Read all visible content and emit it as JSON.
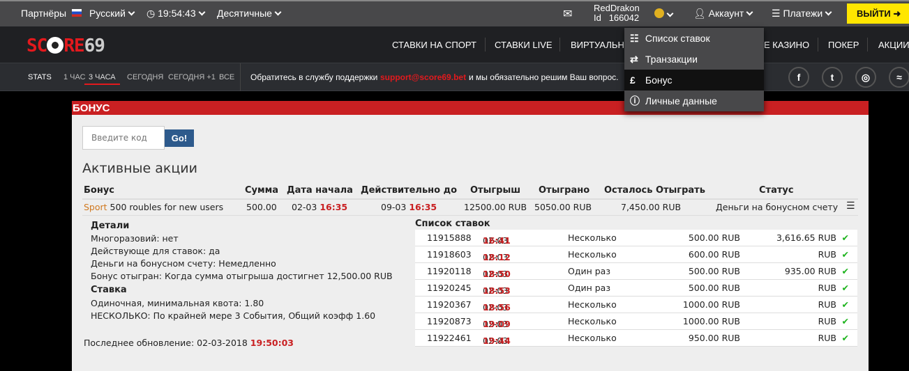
{
  "topbar": {
    "partners": "Партнёры",
    "language": "Русский",
    "time": "19:54:43",
    "odds_format": "Десятичные",
    "username": "RedDrakon",
    "user_id_label": "Id",
    "user_id": "166042",
    "account": "Аккаунт",
    "payments": "Платежи",
    "logout": "ВЫЙТИ"
  },
  "logo": {
    "text_red": "SC",
    "text_red2": "RE",
    "text_grey": "69"
  },
  "nav": {
    "items": [
      "СТАВКИ НА СПОРТ",
      "СТАВКИ LIVE",
      "ВИРТУАЛЬН",
      "Е КАЗИНО",
      "ПОКЕР",
      "АКЦИИ"
    ]
  },
  "stats": {
    "label": "STATS",
    "filters": [
      "1 ЧАС",
      "3 ЧАСА",
      "СЕГОДНЯ",
      "СЕГОДНЯ +1",
      "ВСЕ"
    ],
    "active_filter": "3 ЧАСА",
    "support_text": "Обратитесь в службу поддержки",
    "support_email": "support@score69.bet",
    "support_text2": "и мы обязательно решим Ваш вопрос.",
    "social": [
      "facebook-icon",
      "twitter-icon",
      "instagram-icon",
      "rss-icon"
    ]
  },
  "account_menu": {
    "items": [
      {
        "icon": "list-icon",
        "label": "Список ставок"
      },
      {
        "icon": "transfer-icon",
        "label": "Транзакции"
      },
      {
        "icon": "pound-icon",
        "label": "Бонус"
      },
      {
        "icon": "info-icon",
        "label": "Личные данные"
      }
    ],
    "active": "Бонус"
  },
  "bonus": {
    "title": "БОНУС",
    "code_placeholder": "Введите код",
    "go": "Go!",
    "active_title": "Активные акции",
    "headers": [
      "Бонус",
      "Сумма",
      "Дата начала",
      "Действительно до",
      "Отыгрыш",
      "Отыграно",
      "Осталось Отыграть",
      "Статус"
    ],
    "row": {
      "type": "Sport",
      "name": "500 roubles for new users",
      "amount": "500.00",
      "start_date": "02-03",
      "start_time": "16:35",
      "end_date": "09-03",
      "end_time": "16:35",
      "wager": "12500.00 RUB",
      "wagered": "5050.00 RUB",
      "remaining": "7,450.00 RUB",
      "status": "Деньги на бонусном счету"
    },
    "details_title": "Детали",
    "details": [
      "Многоразовий: нет",
      "Действующе для ставок: да",
      "Деньги на бонусном счету: Немедленно",
      "Бонус отыгран: Когда сумма отыгрыша достигнет 12,500.00 RUB"
    ],
    "bet_title": "Ставка",
    "bet_rules": [
      "Одиночная, минимальная квота: 1.80",
      "НЕСКОЛЬКО: По крайней мере 3 События, Общий коэфф 1.60"
    ],
    "last_update_label": "Последнее обновление: 02-03-2018",
    "last_update_time": "19:50:03",
    "bets_title": "Список ставок",
    "bets": [
      {
        "id": "11915888",
        "date": "02-03",
        "time": "16:41",
        "type": "Несколько",
        "stake": "500.00 RUB",
        "win": "3,616.65 RUB"
      },
      {
        "id": "11918603",
        "date": "02-03",
        "time": "18:12",
        "type": "Несколько",
        "stake": "600.00 RUB",
        "win": "RUB"
      },
      {
        "id": "11920118",
        "date": "02-03",
        "time": "18:50",
        "type": "Один раз",
        "stake": "500.00 RUB",
        "win": "935.00 RUB"
      },
      {
        "id": "11920245",
        "date": "02-03",
        "time": "18:53",
        "type": "Один раз",
        "stake": "500.00 RUB",
        "win": "RUB"
      },
      {
        "id": "11920367",
        "date": "02-03",
        "time": "18:56",
        "type": "Несколько",
        "stake": "1000.00 RUB",
        "win": "RUB"
      },
      {
        "id": "11920873",
        "date": "02-03",
        "time": "19:09",
        "type": "Несколько",
        "stake": "1000.00 RUB",
        "win": "RUB"
      },
      {
        "id": "11922461",
        "date": "02-03",
        "time": "19:44",
        "type": "Несколько",
        "stake": "950.00 RUB",
        "win": "RUB"
      }
    ]
  },
  "colors": {
    "accent_red": "#c92022",
    "logout_yellow": "#ffe600",
    "check_green": "#1db31d"
  }
}
